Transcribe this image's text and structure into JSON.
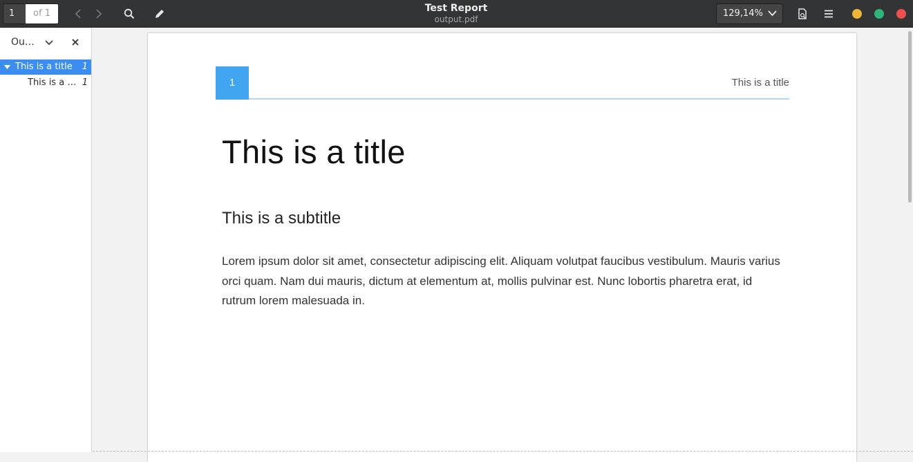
{
  "header": {
    "current_page": "1",
    "of_pages": "of 1",
    "title": "Test Report",
    "filename": "output.pdf",
    "zoom": "129,14%",
    "icons": [
      "chevron-left-icon",
      "chevron-right-icon",
      "search-icon",
      "pencil-icon",
      "document-icon",
      "menu-icon"
    ],
    "window_controls": {
      "minimize": "#f0b536",
      "maximize": "#2db57c",
      "close": "#ee4f4f"
    }
  },
  "sidebar": {
    "title": "Ou…",
    "items": [
      {
        "label": "This is a title",
        "page": "1",
        "selected": true
      },
      {
        "label": "This is a …",
        "page": "1",
        "selected": false
      }
    ]
  },
  "document": {
    "page_number": "1",
    "running_head": "This is a title",
    "title": "This is a title",
    "subtitle": "This is a subtitle",
    "body": "Lorem ipsum dolor sit amet, consectetur adipiscing elit. Aliquam volutpat faucibus vestibulum. Mauris varius orci quam. Nam dui mauris, dictum at elementum at, mollis pulvinar est. Nunc lobortis pharetra erat, id rutrum lorem malesuada in.",
    "accent_color": "#42a5f0"
  }
}
